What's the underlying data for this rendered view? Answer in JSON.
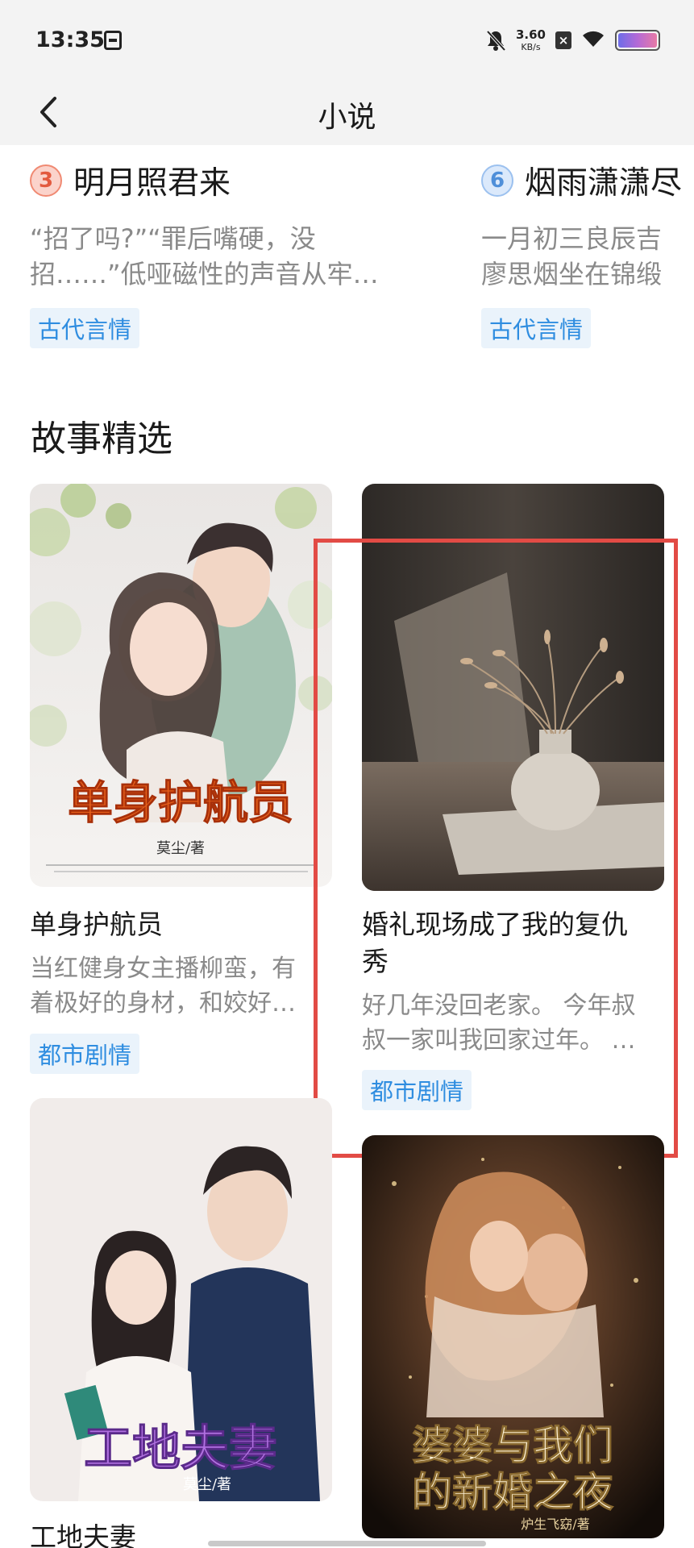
{
  "status_bar": {
    "time": "13:35",
    "net_speed_value": "3.60",
    "net_speed_unit": "KB/s",
    "icons": [
      "calendar-card-icon",
      "bell-muted-icon",
      "x-box-icon",
      "wifi-icon",
      "battery-icon"
    ]
  },
  "nav": {
    "title": "小说",
    "back_icon": "chevron-left-icon"
  },
  "top_cards": [
    {
      "rank": "3",
      "title": "明月照君来",
      "desc_line1": "“招了吗?”“罪后嘴硬，没",
      "desc_line2": "招……”低哑磁性的声音从牢…",
      "tag": "古代言情"
    },
    {
      "rank": "6",
      "title": "烟雨潇潇尽",
      "desc_line1": "一月初三良辰吉",
      "desc_line2": "廖思烟坐在锦缎",
      "tag": "古代言情"
    }
  ],
  "section": {
    "title": "故事精选"
  },
  "books": [
    {
      "title": "单身护航员",
      "desc_line1": "当红健身女主播柳蛮，有",
      "desc_line2": "着极好的身材，和姣好…",
      "tag": "都市剧情",
      "cover_title": "单身护航员",
      "cover_author": "莫尘/著"
    },
    {
      "title_line1": "婚礼现场成了我的复仇",
      "title_line2": "秀",
      "desc_line1": "好几年没回老家。 今年叔",
      "desc_line2": "叔一家叫我回家过年。 …",
      "tag": "都市剧情"
    },
    {
      "title": "工地夫妻",
      "cover_title": "工地夫妻",
      "cover_author": "莫尘/著"
    },
    {
      "cover_title_line1": "婆婆与我们",
      "cover_title_line2": "的新婚之夜",
      "cover_author": "炉生飞窈/著"
    }
  ]
}
